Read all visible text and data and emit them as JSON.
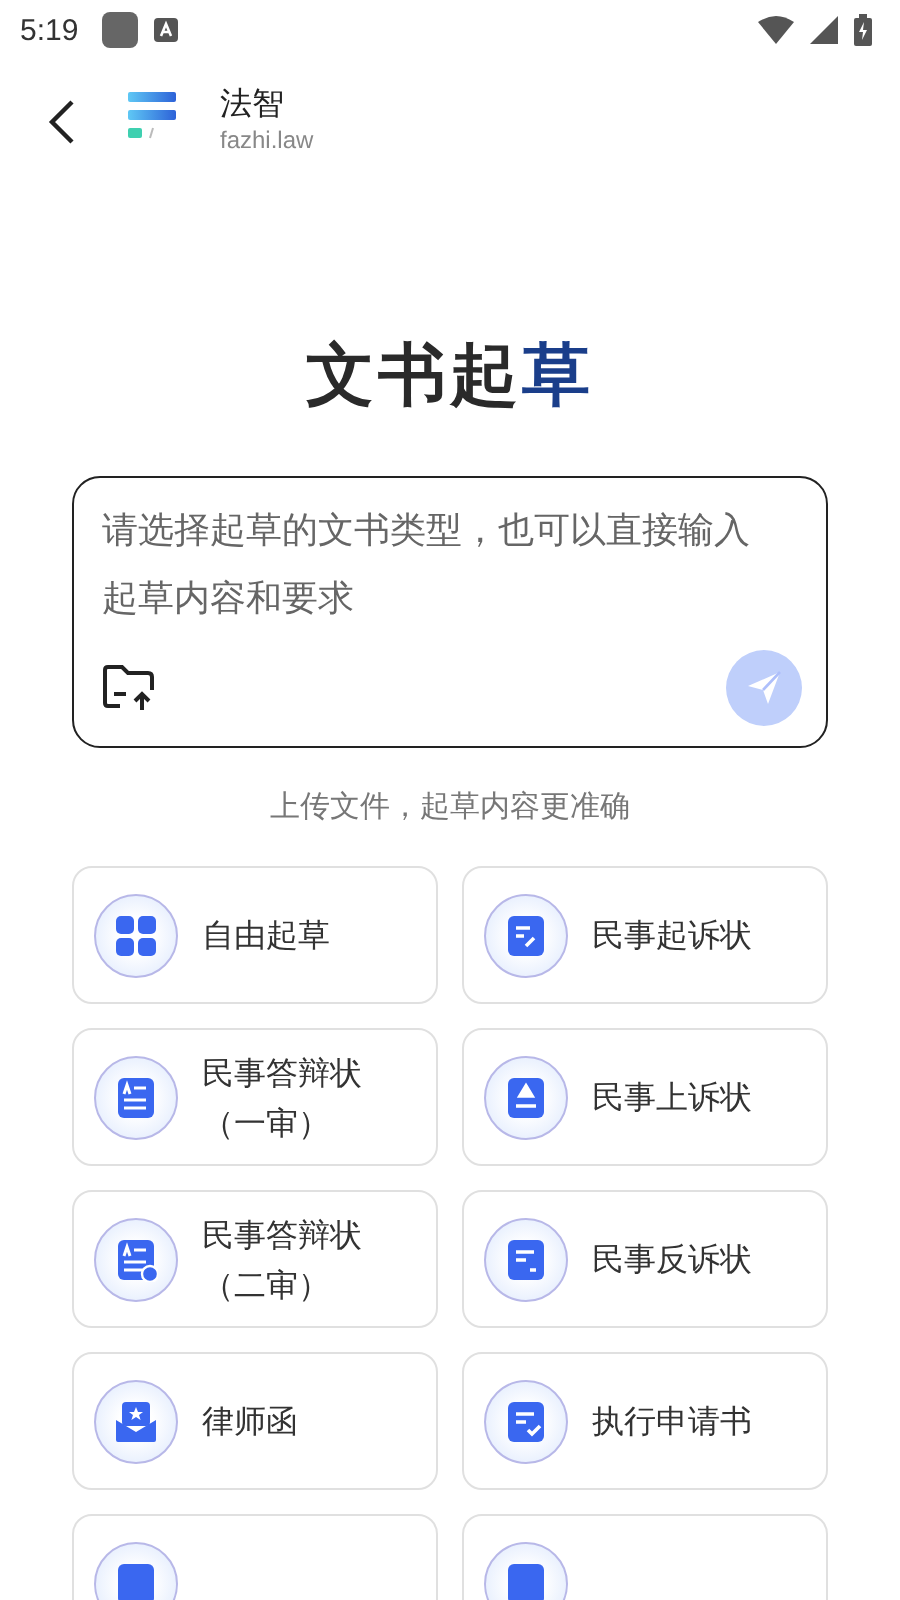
{
  "status_bar": {
    "time": "5:19"
  },
  "header": {
    "app_name": "法智",
    "domain": "fazhi.law"
  },
  "title": [
    {
      "text": "文书起",
      "accent": false
    },
    {
      "text": "草",
      "accent": true
    }
  ],
  "input": {
    "placeholder": "请选择起草的文书类型，也可以直接输入起草内容和要求",
    "send_disabled": true
  },
  "upload_hint": "上传文件，起草内容更准确",
  "cards": [
    {
      "kind": "full",
      "label": "自由起草"
    },
    {
      "kind": "full",
      "label": "民事起诉状"
    },
    {
      "kind": "full",
      "label": "民事答辩状（一审）"
    },
    {
      "kind": "full",
      "label": "民事上诉状"
    },
    {
      "kind": "full",
      "label": "民事答辩状（二审）"
    },
    {
      "kind": "full",
      "label": "民事反诉状"
    },
    {
      "kind": "full",
      "label": "律师函"
    },
    {
      "kind": "full",
      "label": "执行申请书"
    },
    {
      "kind": "partial"
    },
    {
      "kind": "partial"
    }
  ]
}
